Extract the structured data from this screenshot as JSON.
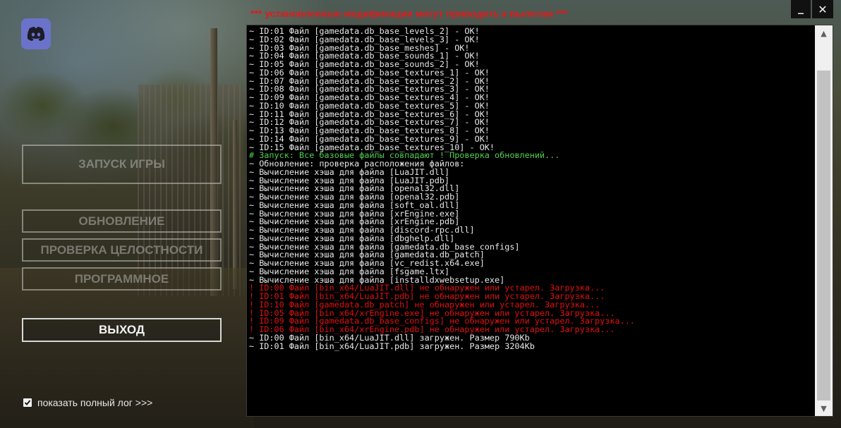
{
  "warning": "*** установленные модификации могут приводить к вылетам ***",
  "window": {
    "minimize": "_",
    "close": "✕"
  },
  "menu": {
    "launch": "ЗАПУСК ИГРЫ",
    "update": "ОБНОВЛЕНИЕ",
    "integrity": "ПРОВЕРКА ЦЕЛОСТНОСТИ",
    "software": "ПРОГРАММНОЕ",
    "exit": "ВЫХОД"
  },
  "full_log": {
    "label": "показать полный лог >>>",
    "checked": true
  },
  "console": {
    "lines": [
      {
        "text": "~ ID:01 Файл [gamedata.db_base_levels_2] - OK!",
        "color": "white"
      },
      {
        "text": "~ ID:02 Файл [gamedata.db_base_levels_3] - OK!",
        "color": "white"
      },
      {
        "text": "~ ID:03 Файл [gamedata.db_base_meshes] - OK!",
        "color": "white"
      },
      {
        "text": "~ ID:04 Файл [gamedata.db_base_sounds_1] - OK!",
        "color": "white"
      },
      {
        "text": "~ ID:05 Файл [gamedata.db_base_sounds_2] - OK!",
        "color": "white"
      },
      {
        "text": "~ ID:06 Файл [gamedata.db_base_textures_1] - OK!",
        "color": "white"
      },
      {
        "text": "~ ID:07 Файл [gamedata.db_base_textures_2] - OK!",
        "color": "white"
      },
      {
        "text": "~ ID:08 Файл [gamedata.db_base_textures_3] - OK!",
        "color": "white"
      },
      {
        "text": "~ ID:09 Файл [gamedata.db_base_textures_4] - OK!",
        "color": "white"
      },
      {
        "text": "~ ID:10 Файл [gamedata.db_base_textures_5] - OK!",
        "color": "white"
      },
      {
        "text": "~ ID:11 Файл [gamedata.db_base_textures_6] - OK!",
        "color": "white"
      },
      {
        "text": "~ ID:12 Файл [gamedata.db_base_textures_7] - OK!",
        "color": "white"
      },
      {
        "text": "~ ID:13 Файл [gamedata.db_base_textures_8] - OK!",
        "color": "white"
      },
      {
        "text": "~ ID:14 Файл [gamedata.db_base_textures_9] - OK!",
        "color": "white"
      },
      {
        "text": "~ ID:15 Файл [gamedata.db_base_textures_10] - OK!",
        "color": "white"
      },
      {
        "text": "# Запуск: Все базовые файлы совпадают ! Проверка обновлений...",
        "color": "green"
      },
      {
        "text": "~ Обновление: проверка расположения файлов:",
        "color": "white"
      },
      {
        "text": "~ Вычисление хэша для файла [LuaJIT.dll]",
        "color": "white"
      },
      {
        "text": "~ Вычисление хэша для файла [LuaJIT.pdb]",
        "color": "white"
      },
      {
        "text": "~ Вычисление хэша для файла [openal32.dll]",
        "color": "white"
      },
      {
        "text": "~ Вычисление хэша для файла [openal32.pdb]",
        "color": "white"
      },
      {
        "text": "~ Вычисление хэша для файла [soft_oal.dll]",
        "color": "white"
      },
      {
        "text": "~ Вычисление хэша для файла [xrEngine.exe]",
        "color": "white"
      },
      {
        "text": "~ Вычисление хэша для файла [xrEngine.pdb]",
        "color": "white"
      },
      {
        "text": "~ Вычисление хэша для файла [discord-rpc.dll]",
        "color": "white"
      },
      {
        "text": "~ Вычисление хэша для файла [dbghelp.dll]",
        "color": "white"
      },
      {
        "text": "~ Вычисление хэша для файла [gamedata.db_base_configs]",
        "color": "white"
      },
      {
        "text": "~ Вычисление хэша для файла [gamedata.db_patch]",
        "color": "white"
      },
      {
        "text": "~ Вычисление хэша для файла [vc_redist.x64.exe]",
        "color": "white"
      },
      {
        "text": "~ Вычисление хэша для файла [fsgame.ltx]",
        "color": "white"
      },
      {
        "text": "~ Вычисление хэша для файла [installdxwebsetup.exe]",
        "color": "white"
      },
      {
        "text": "! ID:00 Файл [bin_x64/LuaJIT.dll] не обнаружен или устарел. Загрузка...",
        "color": "red"
      },
      {
        "text": "! ID:01 Файл [bin_x64/LuaJIT.pdb] не обнаружен или устарел. Загрузка...",
        "color": "red"
      },
      {
        "text": "! ID:10 Файл [gamedata.db_patch] не обнаружен или устарел. Загрузка...",
        "color": "red"
      },
      {
        "text": "! ID:05 Файл [bin_x64/xrEngine.exe] не обнаружен или устарел. Загрузка...",
        "color": "red"
      },
      {
        "text": "! ID:09 Файл [gamedata.db_base_configs] не обнаружен или устарел. Загрузка...",
        "color": "red"
      },
      {
        "text": "! ID:06 Файл [bin_x64/xrEngine.pdb] не обнаружен или устарел. Загрузка...",
        "color": "red"
      },
      {
        "text": "~ ID:00 Файл [bin_x64/LuaJIT.dll] загружен. Размер 790Kb",
        "color": "white"
      },
      {
        "text": "~ ID:01 Файл [bin_x64/LuaJIT.pdb] загружен. Размер 3204Kb",
        "color": "white"
      }
    ]
  },
  "scrollbar": {
    "up_icon": "▲",
    "down_icon": "▼"
  },
  "colors": {
    "warning": "#e01a1a",
    "ok_line": "#e8e8e8",
    "success_line": "#4fd04f",
    "error_line": "#e01010",
    "discord": "#6a73c9"
  }
}
